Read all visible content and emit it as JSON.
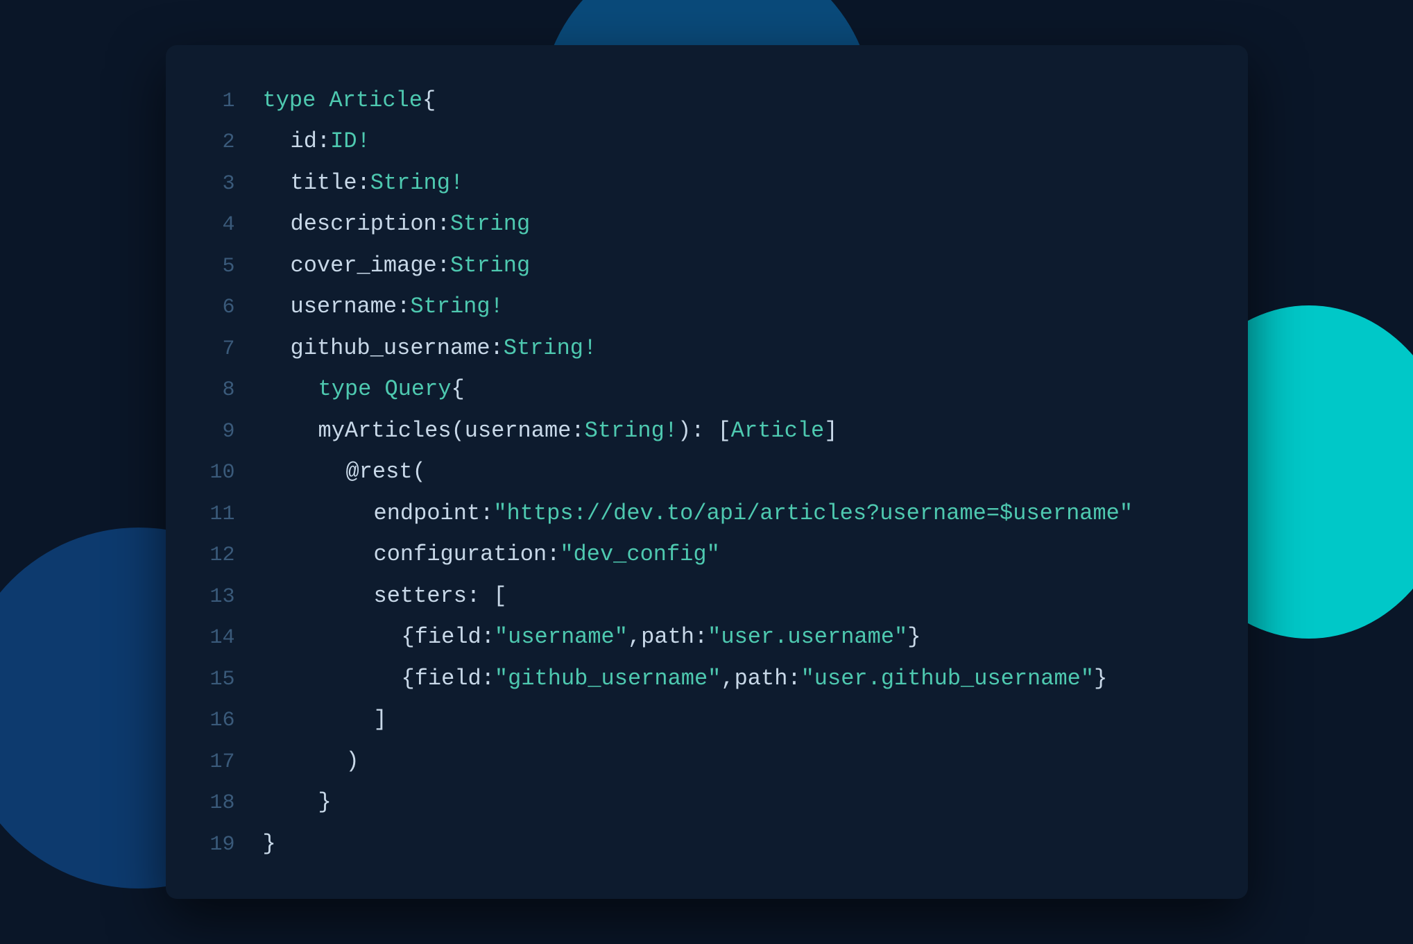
{
  "background": {
    "color": "#0a1628"
  },
  "code": {
    "lines": [
      {
        "num": 1,
        "indent": 0,
        "tokens": [
          {
            "t": "kw",
            "v": "type Article "
          },
          {
            "t": "punctuation",
            "v": "{"
          }
        ]
      },
      {
        "num": 2,
        "indent": 1,
        "tokens": [
          {
            "t": "field-name",
            "v": "id"
          },
          {
            "t": "punctuation",
            "v": ": "
          },
          {
            "t": "type-name",
            "v": "ID!"
          }
        ]
      },
      {
        "num": 3,
        "indent": 1,
        "tokens": [
          {
            "t": "field-name",
            "v": "title"
          },
          {
            "t": "punctuation",
            "v": ": "
          },
          {
            "t": "type-name",
            "v": "String!"
          }
        ]
      },
      {
        "num": 4,
        "indent": 1,
        "tokens": [
          {
            "t": "field-name",
            "v": "description"
          },
          {
            "t": "punctuation",
            "v": ": "
          },
          {
            "t": "type-name",
            "v": "String"
          }
        ]
      },
      {
        "num": 5,
        "indent": 1,
        "tokens": [
          {
            "t": "field-name",
            "v": "cover_image"
          },
          {
            "t": "punctuation",
            "v": ": "
          },
          {
            "t": "type-name",
            "v": "String"
          }
        ]
      },
      {
        "num": 6,
        "indent": 1,
        "tokens": [
          {
            "t": "field-name",
            "v": "username"
          },
          {
            "t": "punctuation",
            "v": ": "
          },
          {
            "t": "type-name",
            "v": "String!"
          }
        ]
      },
      {
        "num": 7,
        "indent": 1,
        "tokens": [
          {
            "t": "field-name",
            "v": "github_username"
          },
          {
            "t": "punctuation",
            "v": ": "
          },
          {
            "t": "type-name",
            "v": "String!"
          }
        ]
      },
      {
        "num": 8,
        "indent": 2,
        "tokens": [
          {
            "t": "kw",
            "v": "type Query "
          },
          {
            "t": "punctuation",
            "v": "{"
          }
        ]
      },
      {
        "num": 9,
        "indent": 2,
        "tokens": [
          {
            "t": "field-name",
            "v": "myArticles"
          },
          {
            "t": "punctuation",
            "v": "("
          },
          {
            "t": "field-name",
            "v": "username"
          },
          {
            "t": "punctuation",
            "v": ": "
          },
          {
            "t": "type-name",
            "v": "String!"
          },
          {
            "t": "punctuation",
            "v": "): ["
          },
          {
            "t": "type-name",
            "v": "Article"
          },
          {
            "t": "punctuation",
            "v": "]"
          }
        ]
      },
      {
        "num": 10,
        "indent": 3,
        "tokens": [
          {
            "t": "field-name",
            "v": "@rest"
          },
          {
            "t": "punctuation",
            "v": "("
          }
        ]
      },
      {
        "num": 11,
        "indent": 4,
        "tokens": [
          {
            "t": "field-name",
            "v": "endpoint"
          },
          {
            "t": "punctuation",
            "v": ": "
          },
          {
            "t": "string-val",
            "v": "\"https://dev.to/api/articles?username=$username\""
          }
        ]
      },
      {
        "num": 12,
        "indent": 4,
        "tokens": [
          {
            "t": "field-name",
            "v": "configuration"
          },
          {
            "t": "punctuation",
            "v": ": "
          },
          {
            "t": "string-val",
            "v": "\"dev_config\""
          }
        ]
      },
      {
        "num": 13,
        "indent": 4,
        "tokens": [
          {
            "t": "field-name",
            "v": "setters"
          },
          {
            "t": "punctuation",
            "v": ": ["
          }
        ]
      },
      {
        "num": 14,
        "indent": 5,
        "tokens": [
          {
            "t": "punctuation",
            "v": "{ "
          },
          {
            "t": "field-name",
            "v": "field"
          },
          {
            "t": "punctuation",
            "v": ": "
          },
          {
            "t": "string-val",
            "v": "\"username\""
          },
          {
            "t": "punctuation",
            "v": ", "
          },
          {
            "t": "field-name",
            "v": "path"
          },
          {
            "t": "punctuation",
            "v": ": "
          },
          {
            "t": "string-val",
            "v": "\"user.username\""
          },
          {
            "t": "punctuation",
            "v": " }"
          }
        ]
      },
      {
        "num": 15,
        "indent": 5,
        "tokens": [
          {
            "t": "punctuation",
            "v": "{ "
          },
          {
            "t": "field-name",
            "v": "field"
          },
          {
            "t": "punctuation",
            "v": ": "
          },
          {
            "t": "string-val",
            "v": "\"github_username\""
          },
          {
            "t": "punctuation",
            "v": ", "
          },
          {
            "t": "field-name",
            "v": "path"
          },
          {
            "t": "punctuation",
            "v": ": "
          },
          {
            "t": "string-val",
            "v": "\"user.github_username\""
          },
          {
            "t": "punctuation",
            "v": " }"
          }
        ]
      },
      {
        "num": 16,
        "indent": 4,
        "tokens": [
          {
            "t": "punctuation",
            "v": "]"
          }
        ]
      },
      {
        "num": 17,
        "indent": 3,
        "tokens": [
          {
            "t": "punctuation",
            "v": ")"
          }
        ]
      },
      {
        "num": 18,
        "indent": 2,
        "tokens": [
          {
            "t": "punctuation",
            "v": "}"
          }
        ]
      },
      {
        "num": 19,
        "indent": 0,
        "tokens": [
          {
            "t": "punctuation",
            "v": "}"
          }
        ]
      }
    ]
  }
}
